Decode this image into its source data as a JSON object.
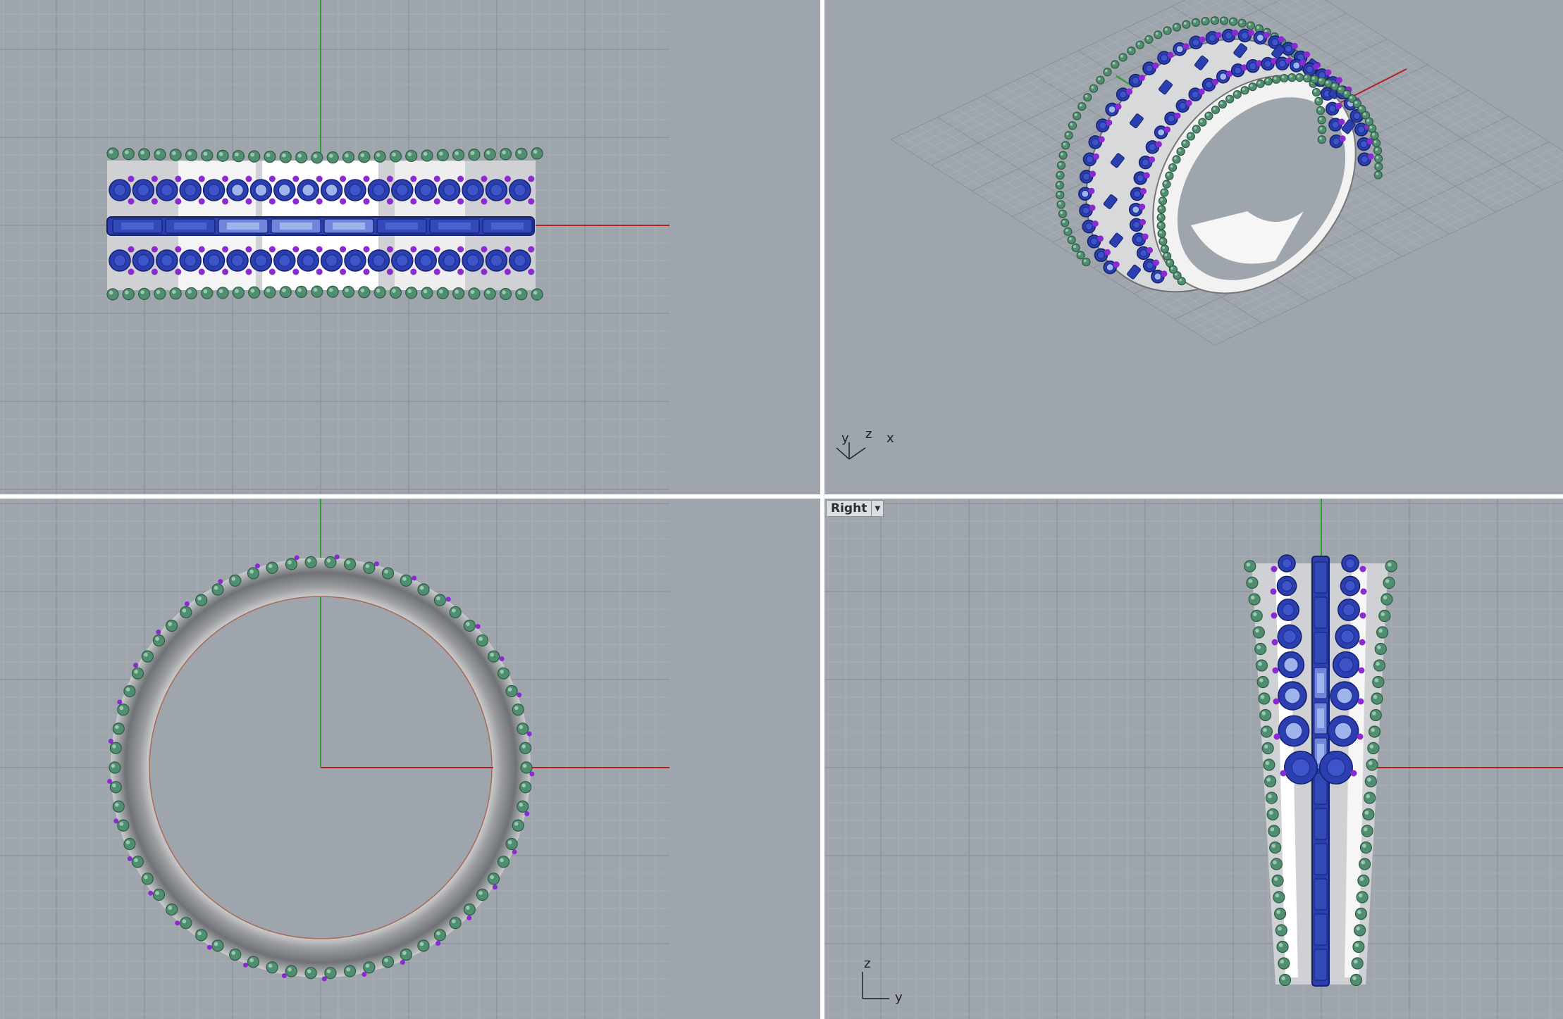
{
  "viewports": {
    "top_left": {
      "name": ""
    },
    "top_right": {
      "name": "",
      "axis_labels": {
        "x": "x",
        "y": "y",
        "z": "z"
      }
    },
    "bottom_left": {
      "name": ""
    },
    "bottom_right": {
      "name": "Right",
      "axis_labels": {
        "z": "z",
        "y": "y"
      }
    }
  },
  "colors": {
    "viewport_bg": "#9fa5ac",
    "grid_minor": "#a9afb5",
    "grid_major": "#8b9096",
    "axis_x": "#b42020",
    "axis_y": "#2aa02a",
    "gem_blue": "#2b3fb0",
    "gem_light": "#9fb4ec",
    "prong_purple": "#8a2ad0",
    "bead_green": "#4f8e6f",
    "metal_silver": "#d9d9d9"
  }
}
